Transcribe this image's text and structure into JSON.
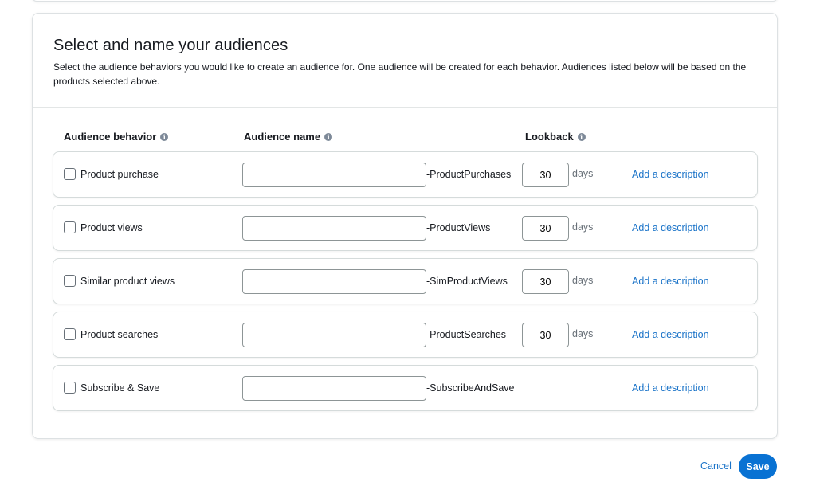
{
  "section": {
    "title": "Select and name your audiences",
    "description": "Select the audience behaviors you would like to create an audience for. One audience will be created for each behavior. Audiences listed below will be based on the products selected above."
  },
  "columns": {
    "behavior": "Audience behavior",
    "name": "Audience name",
    "lookback": "Lookback",
    "info_icon": "info-icon"
  },
  "rows": [
    {
      "label": "Product purchase",
      "name_value": "",
      "suffix": "-ProductPurchases",
      "lookback": "30",
      "days": "days",
      "link": "Add a description",
      "checked": false
    },
    {
      "label": "Product views",
      "name_value": "",
      "suffix": "-ProductViews",
      "lookback": "30",
      "days": "days",
      "link": "Add a description",
      "checked": false
    },
    {
      "label": "Similar product views",
      "name_value": "",
      "suffix": "-SimProductViews",
      "lookback": "30",
      "days": "days",
      "link": "Add a description",
      "checked": false
    },
    {
      "label": "Product searches",
      "name_value": "",
      "suffix": "-ProductSearches",
      "lookback": "30",
      "days": "days",
      "link": "Add a description",
      "checked": false
    },
    {
      "label": "Subscribe & Save",
      "name_value": "",
      "suffix": "-SubscribeAndSave",
      "link": "Add a description",
      "checked": false
    }
  ],
  "footer": {
    "cancel_label": "Cancel",
    "save_label": "Save"
  },
  "colors": {
    "link": "#1a73c8",
    "primary_button": "#0972d3",
    "border": "#d5dbdb",
    "text": "#16191f"
  }
}
